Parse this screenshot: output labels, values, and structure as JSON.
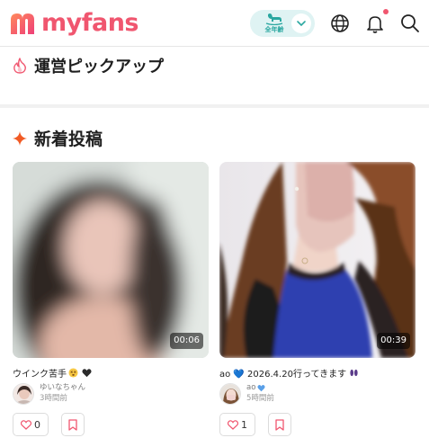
{
  "brand": {
    "name": "myfans",
    "color": "#f0566f"
  },
  "header": {
    "age_filter_label": "全年齢",
    "age_filter_icon": "rocking-horse-icon",
    "language_icon": "globe-icon",
    "notification_icon": "bell-icon",
    "notification_unread": true,
    "search_icon": "search-icon"
  },
  "sections": {
    "pickup": {
      "title": "運営ピックアップ",
      "icon": "flame-icon"
    },
    "new_posts": {
      "title": "新着投稿",
      "icon": "sparkle-icon"
    }
  },
  "posts": [
    {
      "duration": "00:06",
      "caption": "ウインク苦手",
      "caption_emojis": [
        "dizzy-face-emoji",
        "black-heart-emoji"
      ],
      "author": "ゆいなちゃん",
      "author_badge": "",
      "time": "3時間前",
      "likes": "0"
    },
    {
      "duration": "00:39",
      "caption": "ao 💙 2026.4.20行ってきます",
      "caption_emojis": [
        "footprints-emoji"
      ],
      "author": "ao",
      "author_badge": "blue-heart-emoji",
      "time": "5時間前",
      "likes": "1"
    }
  ],
  "colors": {
    "accent": "#f0566f",
    "age_toggle_bg": "#dff3f3",
    "age_toggle_fg": "#2aa7a0",
    "sparkle": "#f15a24"
  }
}
